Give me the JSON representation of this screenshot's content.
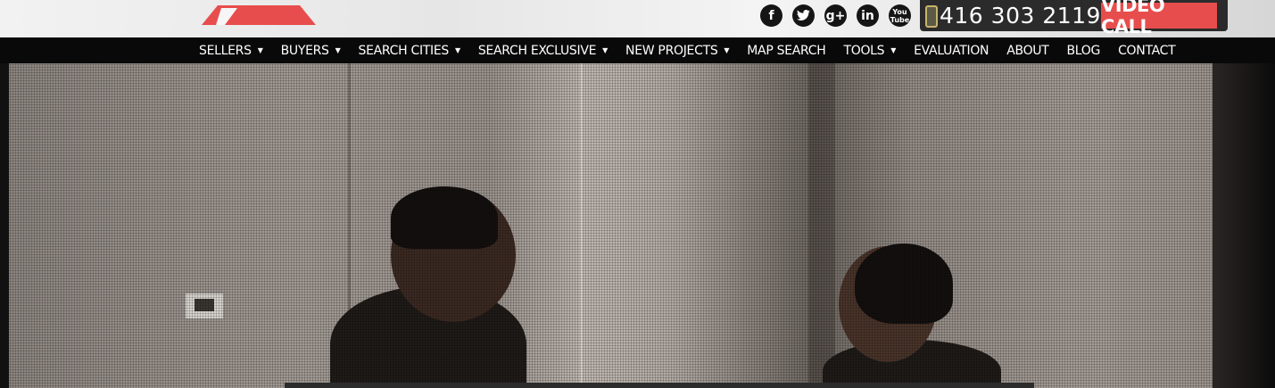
{
  "header": {
    "social_icons": [
      {
        "name": "facebook-icon",
        "glyph": "f"
      },
      {
        "name": "twitter-icon",
        "glyph": "t"
      },
      {
        "name": "google-plus-icon",
        "glyph": "g+"
      },
      {
        "name": "linkedin-icon",
        "glyph": "in"
      },
      {
        "name": "youtube-icon",
        "glyph": "You\nTube"
      }
    ],
    "phone": "416 303 2119",
    "video_call_label": "VIDEO CALL",
    "brand_color": "#e84d4d"
  },
  "nav": {
    "items": [
      {
        "label": "SELLERS",
        "dropdown": true
      },
      {
        "label": "BUYERS",
        "dropdown": true
      },
      {
        "label": "SEARCH CITIES",
        "dropdown": true
      },
      {
        "label": "SEARCH EXCLUSIVE",
        "dropdown": true
      },
      {
        "label": "NEW PROJECTS",
        "dropdown": true
      },
      {
        "label": "MAP SEARCH",
        "dropdown": false
      },
      {
        "label": "TOOLS",
        "dropdown": true
      },
      {
        "label": "EVALUATION",
        "dropdown": false
      },
      {
        "label": "ABOUT",
        "dropdown": false
      },
      {
        "label": "BLOG",
        "dropdown": false
      },
      {
        "label": "CONTACT",
        "dropdown": false
      }
    ]
  }
}
